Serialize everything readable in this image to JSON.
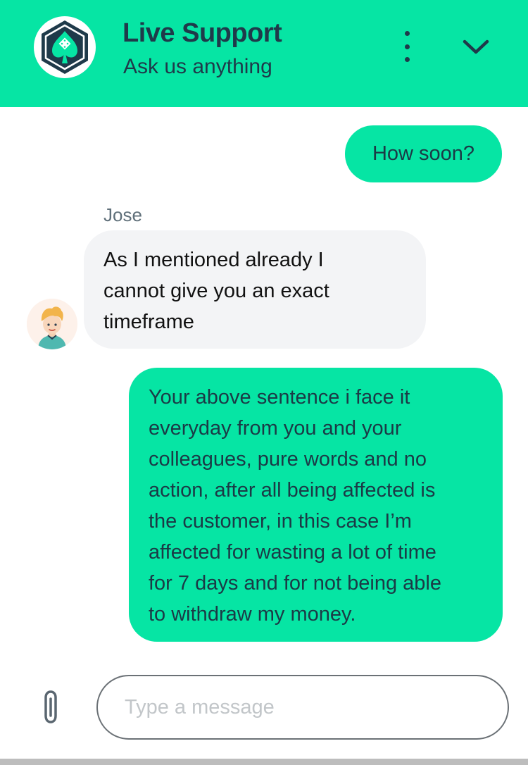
{
  "header": {
    "title": "Live Support",
    "subtitle": "Ask us anything",
    "logo_icon": "spade-logo-icon",
    "menu_icon": "more-vertical-icon",
    "collapse_icon": "chevron-down-icon"
  },
  "messages": [
    {
      "from": "user",
      "text": "How soon?"
    },
    {
      "from": "agent",
      "sender": "Jose",
      "text": "As I mentioned already I\ncannot give you an exact\ntimeframe"
    },
    {
      "from": "user",
      "text": "Your above sentence i face it\neveryday from you and your\ncolleagues, pure words and no\naction, after all being affected is\nthe customer, in this case I’m\naffected for wasting a lot of time\nfor 7 days and for not being able\nto withdraw my money."
    }
  ],
  "composer": {
    "placeholder": "Type a message",
    "value": "",
    "attach_icon": "paperclip-icon"
  },
  "colors": {
    "accent": "#06e5a4",
    "header_text": "#1f3a4a",
    "agent_bubble": "#f3f4f6"
  }
}
